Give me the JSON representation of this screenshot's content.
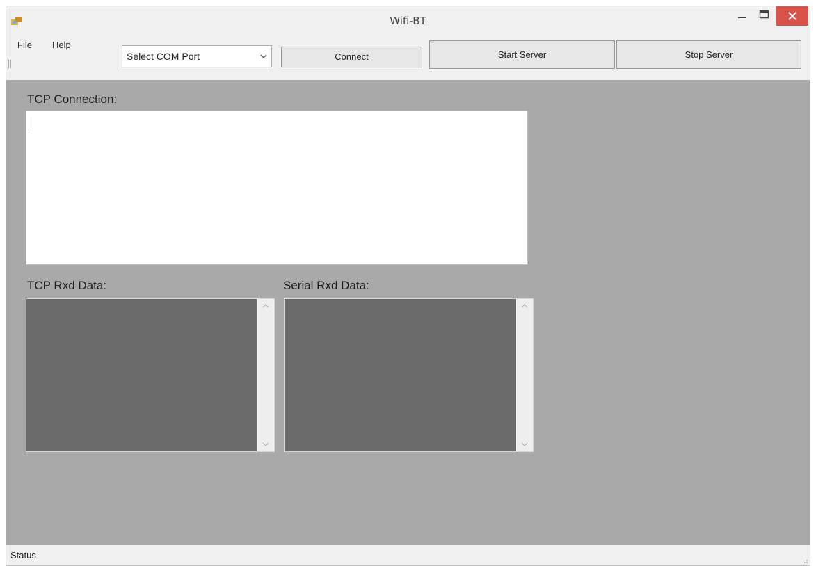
{
  "window": {
    "title": "Wifi-BT"
  },
  "menu": [
    {
      "label": "File"
    },
    {
      "label": "Help"
    }
  ],
  "toolbar": {
    "com_port_select": "Select COM Port",
    "connect_label": "Connect",
    "start_server_label": "Start Server",
    "stop_server_label": "Stop Server"
  },
  "main": {
    "tcp_connection_label": "TCP Connection:",
    "tcp_rxd_label": "TCP Rxd Data:",
    "serial_rxd_label": "Serial Rxd Data:"
  },
  "statusbar": {
    "text": "Status"
  },
  "colors": {
    "close_button": "#d9534b",
    "panel_background": "#a9a9a9",
    "rxd_background": "#6b6b6b"
  }
}
